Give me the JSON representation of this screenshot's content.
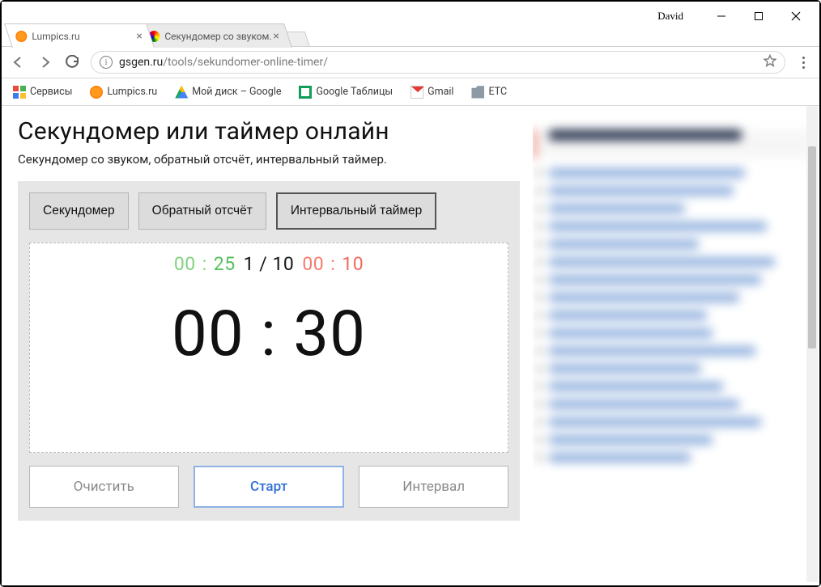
{
  "window": {
    "user_label": "David"
  },
  "tabs": [
    {
      "title": "Lumpics.ru",
      "active": false
    },
    {
      "title": "Секундомер со звуком.",
      "active": true
    }
  ],
  "url": {
    "host": "gsgen.ru",
    "path": "/tools/sekundomer-online-timer/"
  },
  "bookmarks": {
    "apps": "Сервисы",
    "items": [
      {
        "label": "Lumpics.ru",
        "icon": "orange"
      },
      {
        "label": "Мой диск – Google",
        "icon": "drive"
      },
      {
        "label": "Google Таблицы",
        "icon": "sheets"
      },
      {
        "label": "Gmail",
        "icon": "gmail"
      },
      {
        "label": "ETC",
        "icon": "folder"
      }
    ]
  },
  "page": {
    "title": "Секундомер или таймер онлайн",
    "subtitle": "Секундомер со звуком, обратный отсчёт, интервальный таймер.",
    "modes": {
      "stopwatch": "Секундомер",
      "countdown": "Обратный отсчёт",
      "interval": "Интервальный таймер"
    },
    "interval_display": {
      "work_mm": "00",
      "work_ss": "25",
      "round_current": "1",
      "round_total": "10",
      "rest_mm": "00",
      "rest_ss": "10"
    },
    "big_time": "00 : 30",
    "actions": {
      "clear": "Очистить",
      "start": "Старт",
      "interval": "Интервал"
    }
  }
}
